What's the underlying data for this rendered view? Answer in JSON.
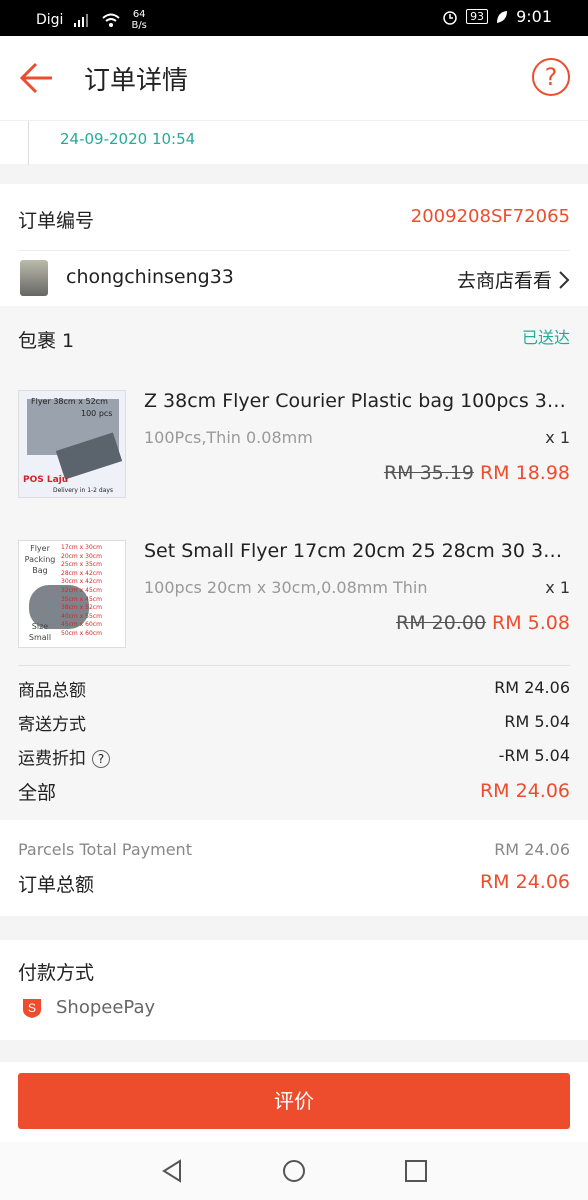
{
  "status_bar": {
    "carrier": "Digi",
    "net_speed": "64",
    "net_unit": "B/s",
    "battery": "93",
    "time": "9:01"
  },
  "header": {
    "title": "订单详情",
    "help_label": "?"
  },
  "tracking": {
    "date": "24-09-2020 10:54"
  },
  "order": {
    "number_label": "订单编号",
    "number": "2009208SF72065",
    "shop_name": "chongchinseng33",
    "shop_link": "去商店看看"
  },
  "package": {
    "label": "包裹 1",
    "status": "已送达",
    "items": [
      {
        "name": "Z 38cm Flyer Courier Plastic bag 100pcs 38 ...",
        "variation": "100Pcs,Thin 0.08mm",
        "qty": "x 1",
        "old_price": "RM 35.19",
        "new_price": "RM 18.98",
        "thumb_title": "Flyer 38cm x 52cm",
        "thumb_sub": "100 pcs",
        "thumb_brand": "POS Laju",
        "thumb_foot": "Delivery in 1-2 days"
      },
      {
        "name": "Set Small Flyer 17cm 20cm 25 28cm 30 32 3...",
        "variation": "100pcs 20cm x 30cm,0.08mm Thin",
        "qty": "x 1",
        "old_price": "RM 20.00",
        "new_price": "RM 5.08",
        "thumb_title": "Flyer Packing Bag",
        "thumb_size": "Size Small",
        "thumb_list": [
          "17cm x 30cm",
          "20cm x 30cm",
          "25cm x 35cm",
          "28cm x 42cm",
          "30cm x 42cm",
          "32cm x 45cm",
          "35cm x 45cm",
          "38cm x 52cm",
          "40cm x 55cm",
          "45cm x 60cm",
          "50cm x 60cm"
        ]
      }
    ],
    "summary": {
      "subtotal_label": "商品总额",
      "subtotal": "RM 24.06",
      "shipping_label": "寄送方式",
      "shipping": "RM 5.04",
      "discount_label": "运费折扣",
      "discount": "-RM 5.04",
      "total_label": "全部",
      "total": "RM 24.06"
    }
  },
  "payment": {
    "parcels_label": "Parcels Total Payment",
    "parcels_value": "RM 24.06",
    "order_total_label": "订单总额",
    "order_total_value": "RM 24.06",
    "method_label": "付款方式",
    "method": "ShopeePay"
  },
  "action": {
    "rate_button": "评价"
  },
  "colors": {
    "accent": "#ee4d2d",
    "teal": "#26aa99"
  }
}
